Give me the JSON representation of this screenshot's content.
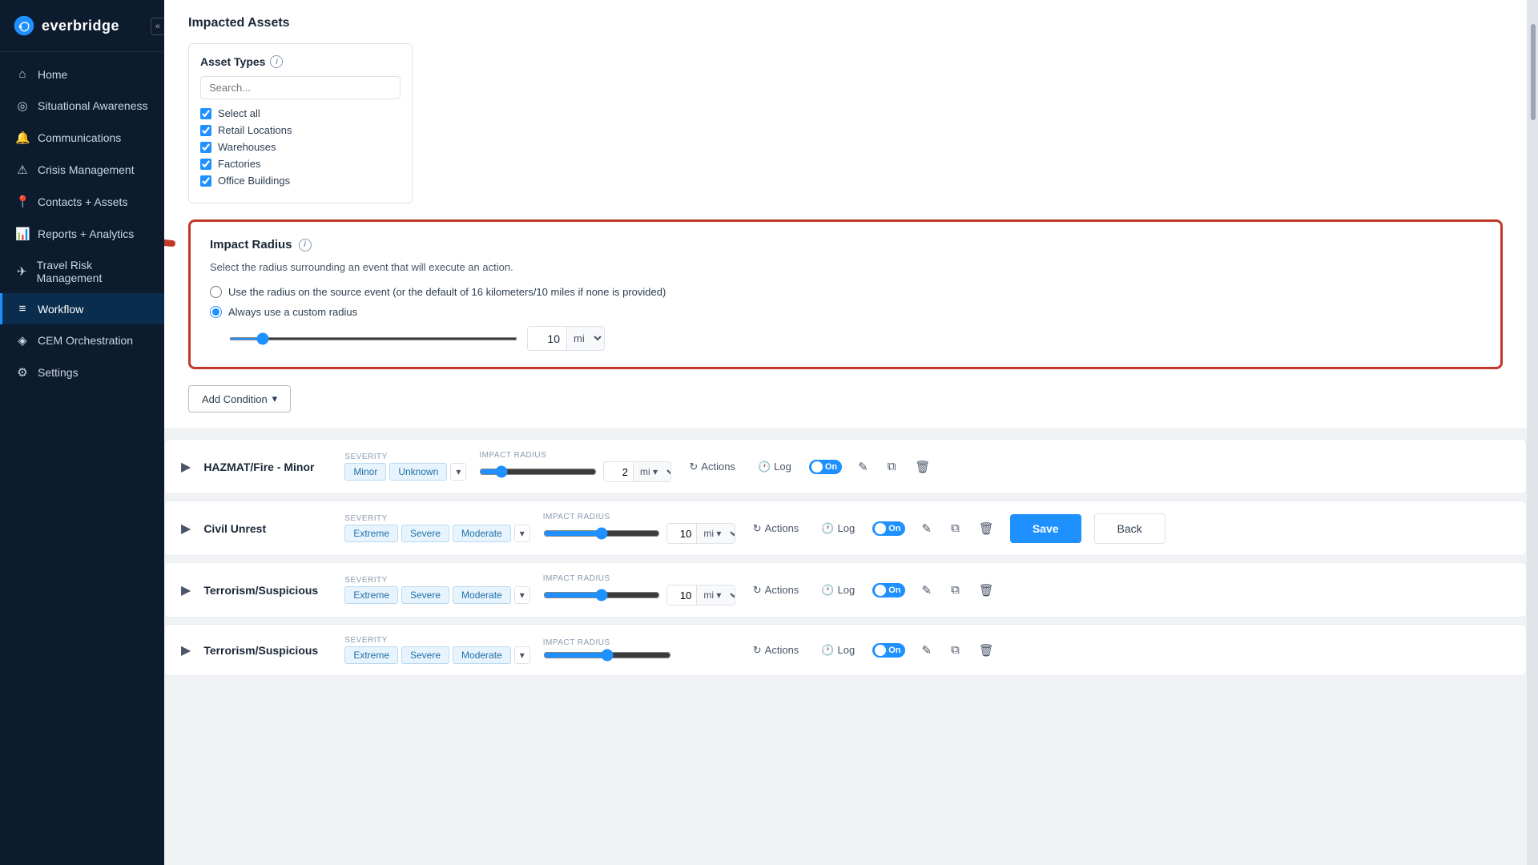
{
  "sidebar": {
    "logo_text": "everbridge",
    "collapse_label": "«",
    "items": [
      {
        "id": "home",
        "label": "Home",
        "icon": "⌂",
        "active": false
      },
      {
        "id": "situational-awareness",
        "label": "Situational Awareness",
        "icon": "◎",
        "active": false
      },
      {
        "id": "communications",
        "label": "Communications",
        "icon": "🔔",
        "active": false
      },
      {
        "id": "crisis-management",
        "label": "Crisis Management",
        "icon": "⚠",
        "active": false
      },
      {
        "id": "contacts-assets",
        "label": "Contacts + Assets",
        "icon": "📍",
        "active": false
      },
      {
        "id": "reports-analytics",
        "label": "Reports + Analytics",
        "icon": "📊",
        "active": false
      },
      {
        "id": "travel-risk",
        "label": "Travel Risk Management",
        "icon": "✈",
        "active": false
      },
      {
        "id": "workflow",
        "label": "Workflow",
        "icon": "≡",
        "active": true
      },
      {
        "id": "cem",
        "label": "CEM Orchestration",
        "icon": "◈",
        "active": false
      },
      {
        "id": "settings",
        "label": "Settings",
        "icon": "⚙",
        "active": false
      }
    ]
  },
  "impacted_assets": {
    "title": "Impacted Assets",
    "asset_types": {
      "label": "Asset Types",
      "search_placeholder": "Search...",
      "select_all_label": "Select all",
      "items": [
        {
          "label": "Retail Locations",
          "checked": true
        },
        {
          "label": "Warehouses",
          "checked": true
        },
        {
          "label": "Factories",
          "checked": true
        },
        {
          "label": "Office Buildings",
          "checked": true
        }
      ]
    }
  },
  "impact_radius": {
    "title": "Impact Radius",
    "description": "Select the radius surrounding an event that will execute an action.",
    "option1_label": "Use the radius on the source event (or the default of 16 kilometers/10 miles if none is provided)",
    "option2_label": "Always use a custom radius",
    "slider_value": 10,
    "slider_min": 0,
    "slider_max": 100,
    "radius_value": "10",
    "radius_unit": "mi",
    "unit_options": [
      "mi",
      "km"
    ]
  },
  "add_condition": {
    "label": "Add Condition",
    "chevron": "▾"
  },
  "condition_rows": [
    {
      "id": "hazmat",
      "title": "HAZMAT/Fire - Minor",
      "severity_label": "Severity",
      "severity_tags": [
        "Minor",
        "Unknown"
      ],
      "impact_radius_label": "Impact Radius",
      "radius_value": "2",
      "radius_unit": "mi",
      "slider_value": 15,
      "actions_label": "Actions",
      "log_label": "Log",
      "toggle_label": "On"
    },
    {
      "id": "civil-unrest",
      "title": "Civil Unrest",
      "severity_label": "Severity",
      "severity_tags": [
        "Extreme",
        "Severe",
        "Moderate"
      ],
      "impact_radius_label": "Impact Radius",
      "radius_value": "10",
      "radius_unit": "mi",
      "slider_value": 50,
      "actions_label": "Actions",
      "log_label": "Log",
      "toggle_label": "On"
    },
    {
      "id": "terrorism",
      "title": "Terrorism/Suspicious",
      "severity_label": "Severity",
      "severity_tags": [
        "Extreme",
        "Severe",
        "Moderate"
      ],
      "impact_radius_label": "Impact Radius",
      "radius_value": "10",
      "radius_unit": "mi",
      "slider_value": 50,
      "actions_label": "Actions",
      "log_label": "Log",
      "toggle_label": "On"
    }
  ],
  "buttons": {
    "save_label": "Save",
    "back_label": "Back"
  }
}
